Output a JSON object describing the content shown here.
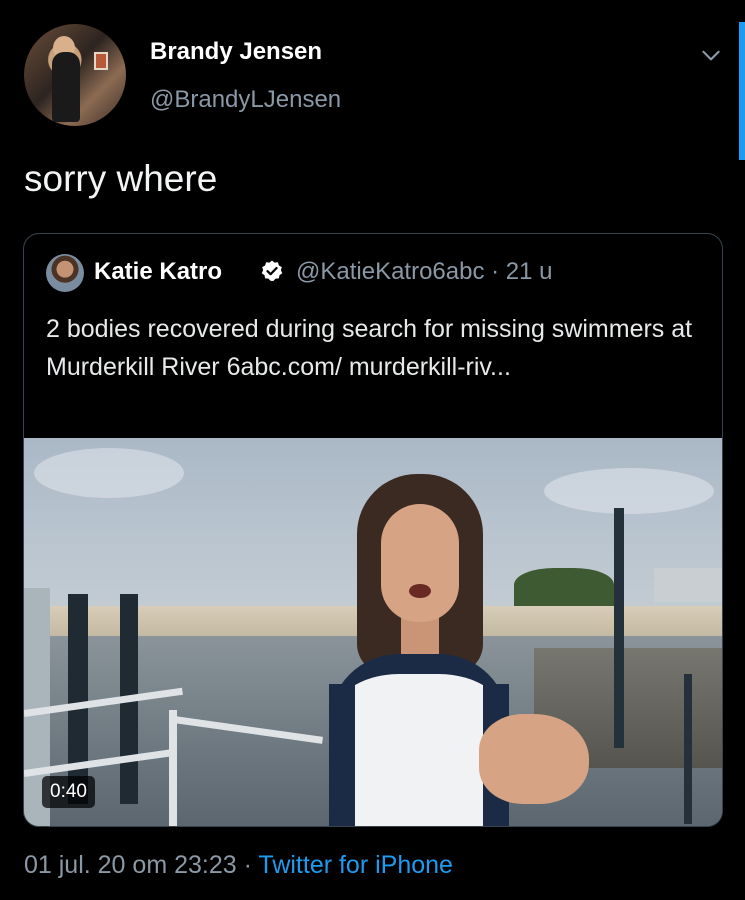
{
  "author": {
    "name": "Brandy Jensen",
    "handle": "@BrandyLJensen"
  },
  "tweet": {
    "text": "sorry where"
  },
  "quoted_tweet": {
    "name": "Katie Katro",
    "handle_time": "@KatieKatro6abc · 21 u",
    "text": "2 bodies recovered during search for missing swimmers at Murderkill River 6abc.com/ murderkill-riv...",
    "video_duration": "0:40"
  },
  "meta": {
    "timestamp": "01 jul. 20 om 23:23",
    "separator": " · ",
    "source": "Twitter for iPhone"
  },
  "icons": {
    "menu": "chevron-down-icon",
    "verified": "verified-badge-icon"
  },
  "colors": {
    "background": "#000000",
    "accent": "#1d9bf0",
    "secondary_text": "#8b98a5"
  }
}
